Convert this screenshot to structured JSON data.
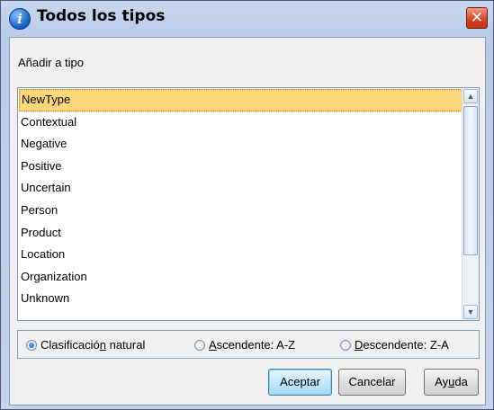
{
  "window": {
    "title": "Todos los tipos",
    "close_symbol": "✕"
  },
  "dialog": {
    "section_label": "Añadir a tipo",
    "types": [
      "NewType",
      "Contextual",
      "Negative",
      "Positive",
      "Uncertain",
      "Person",
      "Product",
      "Location",
      "Organization",
      "Unknown"
    ],
    "selected_type": "NewType",
    "sort_options": {
      "natural": {
        "pre": "Clasificació",
        "key": "n",
        "post": " natural",
        "checked": true
      },
      "asc": {
        "pre": "",
        "key": "A",
        "post": "scendente: A-Z",
        "checked": false
      },
      "desc": {
        "pre": "",
        "key": "D",
        "post": "escendente: Z-A",
        "checked": false
      }
    },
    "buttons": {
      "ok": "Aceptar",
      "cancel": "Cancelar",
      "help_pre": "Ay",
      "help_key": "u",
      "help_post": "da"
    }
  },
  "icons": {
    "title_icon": "info-icon",
    "close_icon": "close-icon"
  },
  "colors": {
    "selection": "#fbd77a",
    "titlebar": "#c4d4ec",
    "close": "#d6452a"
  }
}
